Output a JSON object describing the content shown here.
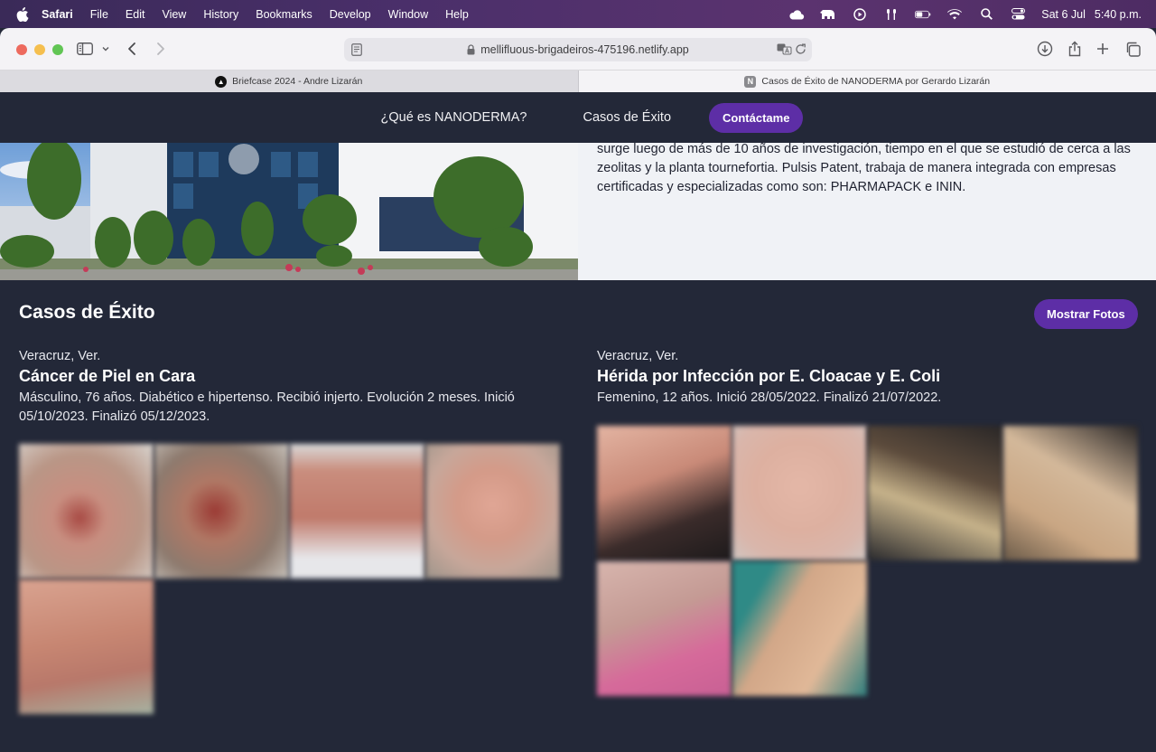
{
  "menubar": {
    "items": [
      "Safari",
      "File",
      "Edit",
      "View",
      "History",
      "Bookmarks",
      "Develop",
      "Window",
      "Help"
    ],
    "date": "Sat 6 Jul",
    "time": "5:40 p.m."
  },
  "browser": {
    "url": "mellifluous-brigadeiros-475196.netlify.app",
    "tabs": [
      {
        "title": "Briefcase 2024 - Andre Lizarán"
      },
      {
        "title": "Casos de Éxito de NANODERMA por Gerardo Lizarán"
      }
    ]
  },
  "nav": {
    "link1": "¿Qué es NANODERMA?",
    "link2": "Casos de Éxito",
    "cta": "Contáctame"
  },
  "hero": {
    "text": "surge luego de más de 10 años de investigación, tiempo en el que se estudió de cerca a las zeolitas y la planta tournefortia. Pulsis Patent, trabaja de manera integrada con empresas certificadas y especializadas como son: PHARMAPACK e ININ."
  },
  "section": {
    "title": "Casos de Éxito",
    "button": "Mostrar Fotos"
  },
  "cases": [
    {
      "location": "Veracruz, Ver.",
      "title": "Cáncer de Piel en Cara",
      "description": "Másculino, 76 años. Diabético e hipertenso. Recibió injerto. Evolución 2 meses. Inició 05/10/2023. Finalizó 05/12/2023."
    },
    {
      "location": "Veracruz, Ver.",
      "title": "Hérida por Infección por E. Cloacae y E. Coli",
      "description": "Femenino, 12 años. Inició 28/05/2022. Finalizó 21/07/2022."
    }
  ],
  "colors": {
    "page_bg": "#232838",
    "accent": "#5d2ea6",
    "hero_text_bg": "#f0f2f6"
  }
}
